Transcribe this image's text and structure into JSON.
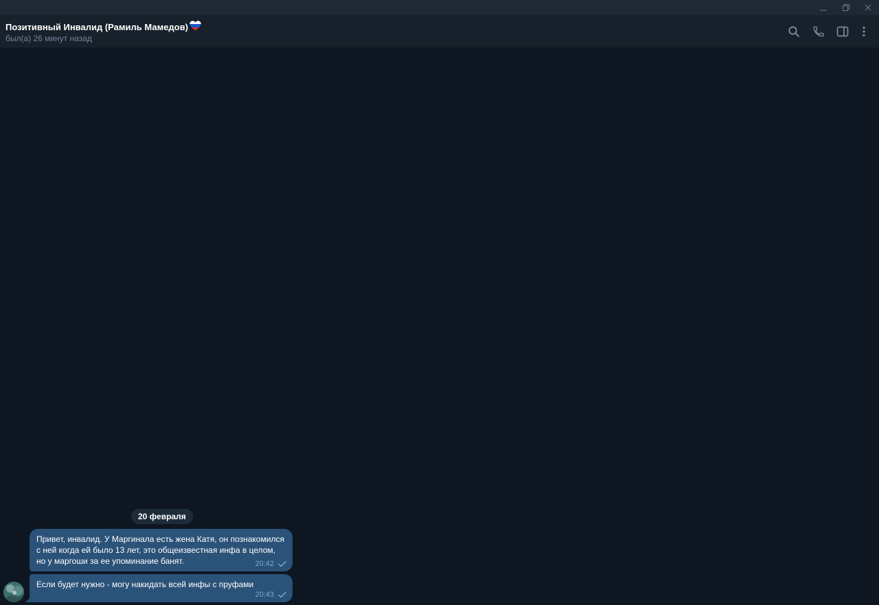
{
  "titlebar": {
    "minimize_icon": "minimize-icon",
    "restore_icon": "restore-icon",
    "close_icon": "close-icon"
  },
  "header": {
    "title": "Позитивный Инвалид (Рамиль Мамедов)",
    "title_emoji_icon": "russian-flag-heart-icon",
    "status": "был(а) 26 минут назад",
    "icons": [
      "search-icon",
      "phone-icon",
      "sidebar-toggle-icon",
      "more-vertical-icon"
    ]
  },
  "chat": {
    "date_separator": "20 февраля",
    "messages": [
      {
        "text": "Привет, инвалид. У Маргинала есть жена Катя, он познакомился с ней когда ей было 13 лет, это общеизвестная инфа в целом, но у маргоши за ее упоминание банят.",
        "time": "20:42",
        "status_icon": "single-check-icon"
      },
      {
        "text": "Если будет нужно - могу накидать всей инфы с пруфами",
        "time": "20:43",
        "status_icon": "single-check-icon"
      }
    ]
  },
  "colors": {
    "background": "#0e1621",
    "header": "#17212b",
    "titlebar": "#1f2936",
    "bubble": "#2b5278",
    "meta_text": "#7da8d3",
    "status_text": "#708499",
    "icon": "#7f8b97"
  }
}
